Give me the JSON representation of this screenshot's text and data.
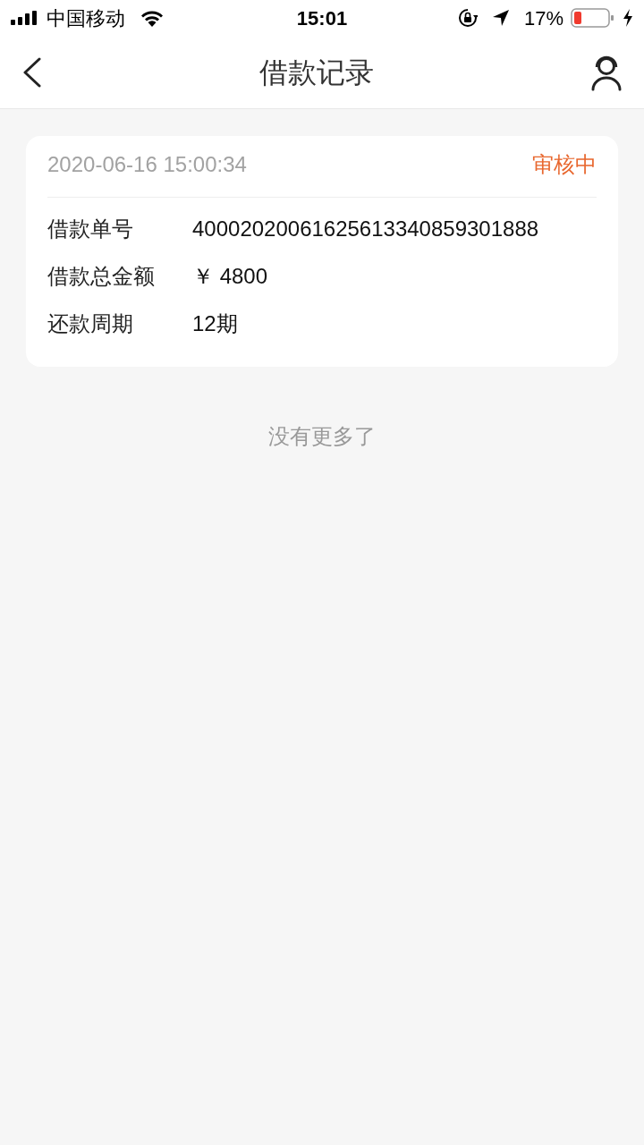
{
  "status_bar": {
    "carrier": "中国移动",
    "time": "15:01",
    "battery_text": "17%"
  },
  "nav": {
    "title": "借款记录"
  },
  "records": [
    {
      "datetime": "2020-06-16 15:00:34",
      "status": "审核中",
      "fields": [
        {
          "label": "借款单号",
          "value": "40002020061625613340859301888"
        },
        {
          "label": "借款总金额",
          "value": "￥ 4800"
        },
        {
          "label": "还款周期",
          "value": "12期"
        }
      ]
    }
  ],
  "footer": "没有更多了"
}
